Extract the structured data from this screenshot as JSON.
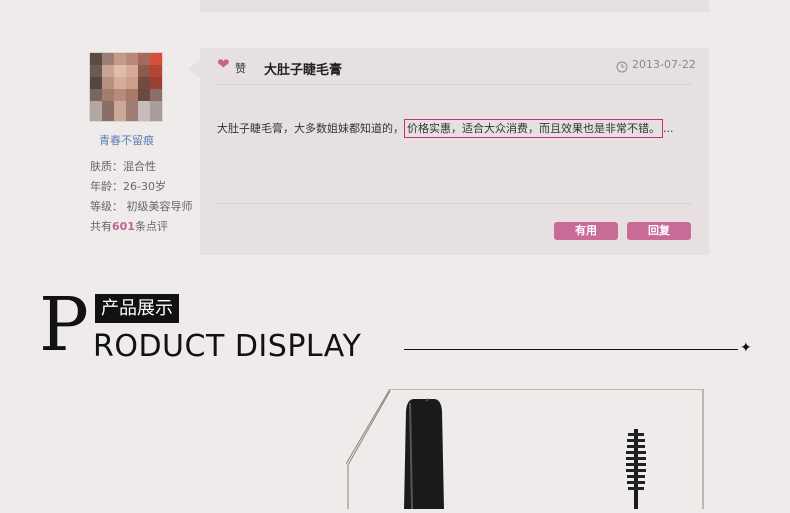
{
  "review": {
    "user": {
      "name": "青春不留痕",
      "skin": "肤质：混合性",
      "age": "年龄：26-30岁",
      "level": "等级： 初级美容导师",
      "count_prefix": "共有",
      "count": "601",
      "count_suffix": "条点评"
    },
    "like_label": "赞",
    "title": "大肚子睫毛膏",
    "date": "2013-07-22",
    "text_before": "大肚子睫毛膏，大多数姐妹都知道的，",
    "text_highlight": "价格实惠，适合大众消费，而且效果也是非常不错。",
    "text_after": "...",
    "useful_label": "有用",
    "reply_label": "回复"
  },
  "section": {
    "big_letter": "P",
    "cn_label": "产品展示",
    "en_heading": "RODUCT DISPLAY",
    "line_end_icon": "✦"
  },
  "colors": {
    "accent": "#c96b97",
    "highlight_border": "#c0308a",
    "username": "#5b7fb0"
  }
}
